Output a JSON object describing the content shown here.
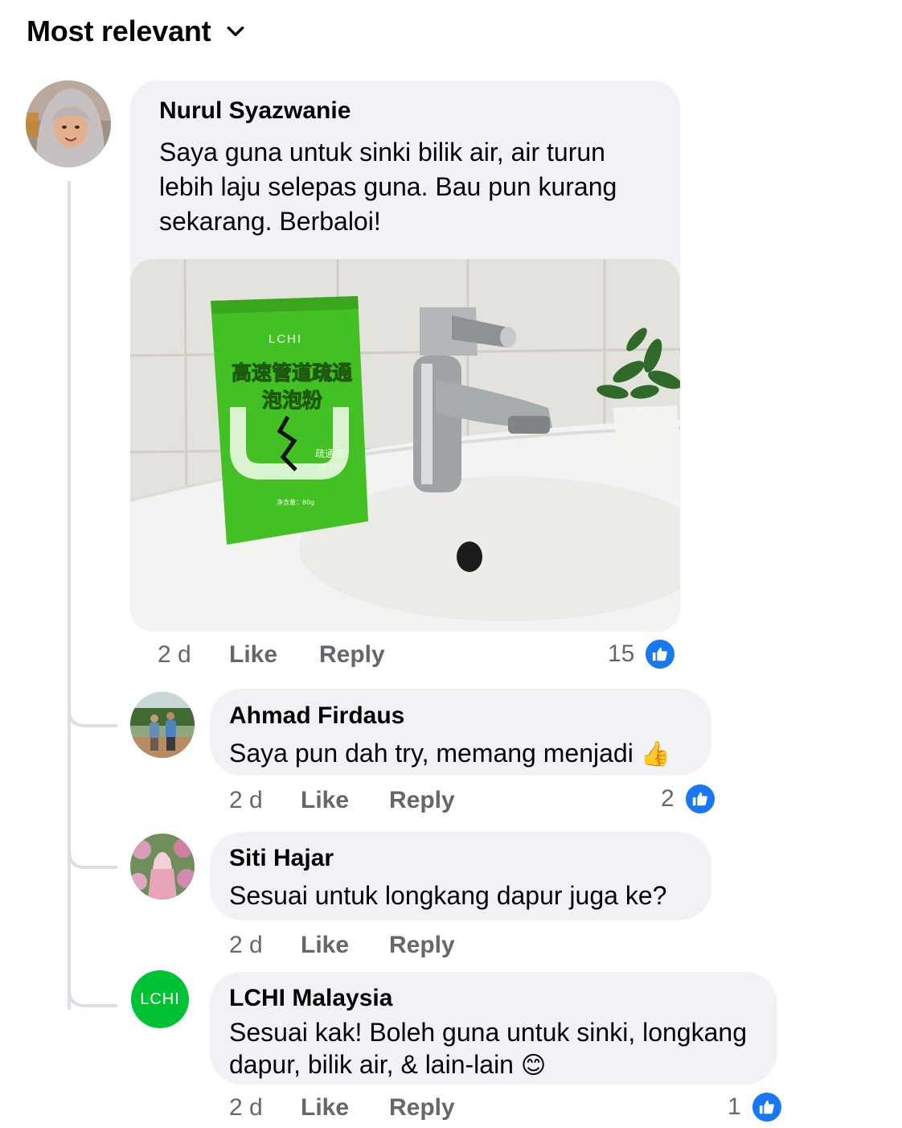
{
  "sort": {
    "label": "Most relevant"
  },
  "comment": {
    "author": "Nurul Syazwanie",
    "lines": [
      "Saya guna untuk sinki bilik air, air turun",
      "lebih laju selepas guna. Bau pun kurang",
      "sekarang. Berbaloi!"
    ],
    "photo": {
      "brand": "LCHI",
      "title_line1": "高速管道疏通",
      "title_line2": "泡泡粉",
      "rate_label": "疏通率",
      "rate_value": "99.9%*",
      "weight": "净含量：80g"
    },
    "time": "2 d",
    "like_label": "Like",
    "reply_label": "Reply",
    "like_count": "15"
  },
  "replies": [
    {
      "author": "Ahmad Firdaus",
      "text": "Saya pun dah try, memang menjadi",
      "emoji": "👍",
      "time": "2 d",
      "like_label": "Like",
      "reply_label": "Reply",
      "like_count": "2"
    },
    {
      "author": "Siti Hajar",
      "text": "Sesuai untuk longkang dapur juga ke?",
      "time": "2 d",
      "like_label": "Like",
      "reply_label": "Reply"
    },
    {
      "author": "LCHI Malaysia",
      "avatar_text": "LCHI",
      "lines": [
        "Sesuai kak! Boleh guna untuk sinki, longkang",
        "dapur, bilik air, & lain-lain"
      ],
      "emoji": "😊",
      "time": "2 d",
      "like_label": "Like",
      "reply_label": "Reply",
      "like_count": "1"
    }
  ],
  "colors": {
    "bubble": "#f0f2f5",
    "meta": "#65676b",
    "like_blue": "#1877f2",
    "brand_green": "#00c234"
  }
}
